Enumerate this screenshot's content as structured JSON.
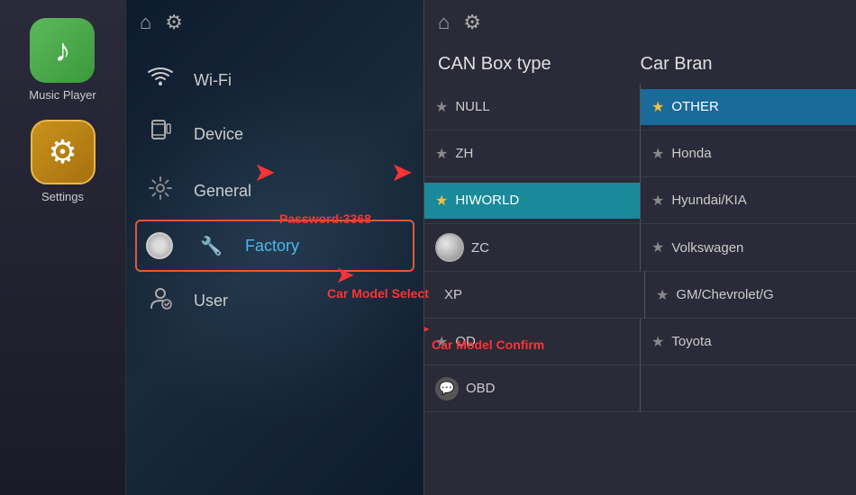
{
  "sidebar": {
    "apps": [
      {
        "id": "music-player",
        "label": "Music Player",
        "icon": "♪",
        "icon_type": "music"
      },
      {
        "id": "settings",
        "label": "Settings",
        "icon": "⚙",
        "icon_type": "settings",
        "active": true
      }
    ]
  },
  "settings_panel": {
    "topbar": {
      "home_icon": "⌂",
      "gear_icon": "⚙"
    },
    "menu_items": [
      {
        "id": "wifi",
        "label": "Wi-Fi",
        "icon": "📶",
        "active": false
      },
      {
        "id": "device",
        "label": "Device",
        "icon": "📱",
        "active": false
      },
      {
        "id": "general",
        "label": "General",
        "icon": "⚙",
        "active": false
      },
      {
        "id": "factory",
        "label": "Factory",
        "icon": "🔧",
        "active": true
      },
      {
        "id": "user",
        "label": "User",
        "icon": "👤",
        "active": false
      }
    ],
    "annotations": {
      "password": "Password:3368",
      "car_model_select": "Car Model Select",
      "car_model_confirm": "Car Model Confirm"
    }
  },
  "can_panel": {
    "topbar": {
      "home_icon": "⌂",
      "gear_icon": "⚙"
    },
    "headers": {
      "left": "CAN Box type",
      "right": "Car Bran"
    },
    "rows": [
      {
        "left": {
          "star": "★",
          "star_style": "normal",
          "text": "NULL"
        },
        "right": {
          "star": "★",
          "star_style": "gold",
          "text": "OTHER",
          "highlighted": true
        }
      },
      {
        "left": {
          "star": "★",
          "star_style": "normal",
          "text": "ZH"
        },
        "right": {
          "star": "★",
          "star_style": "normal",
          "text": "Honda"
        }
      },
      {
        "left": {
          "star": "★",
          "star_style": "gold",
          "text": "HIWORLD",
          "highlighted": true
        },
        "right": {
          "star": "★",
          "star_style": "normal",
          "text": "Hyundai/KIA"
        }
      },
      {
        "left": {
          "toggle": true,
          "text": "ZC"
        },
        "right": {
          "star": "★",
          "star_style": "normal",
          "text": "Volkswagen"
        }
      },
      {
        "left": {
          "text": "XP",
          "no_star": true
        },
        "right": {
          "star": "★",
          "star_style": "normal",
          "text": "GM/Chevrolet/G"
        }
      },
      {
        "left": {
          "star": "★",
          "star_style": "normal",
          "text": "OD"
        },
        "right": {
          "star": "★",
          "star_style": "normal",
          "text": "Toyota"
        }
      },
      {
        "left": {
          "obd": true,
          "text": "OBD"
        },
        "right": {
          "text": ""
        }
      }
    ]
  }
}
